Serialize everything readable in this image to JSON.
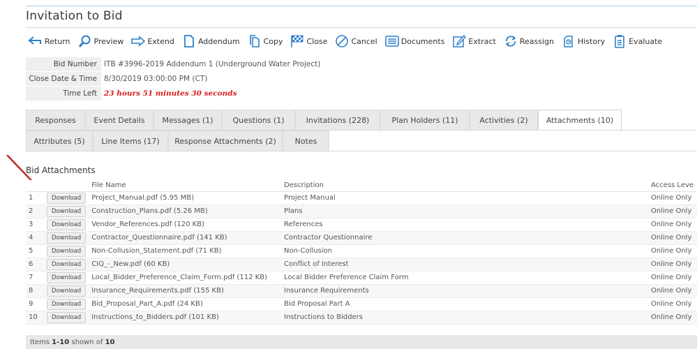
{
  "page": {
    "title": "Invitation to Bid"
  },
  "toolbar": {
    "buttons": [
      {
        "label": "Return",
        "icon": "return-arrow-icon"
      },
      {
        "label": "Preview",
        "icon": "magnifier-icon"
      },
      {
        "label": "Extend",
        "icon": "right-arrow-icon"
      },
      {
        "label": "Addendum",
        "icon": "document-icon"
      },
      {
        "label": "Copy",
        "icon": "copy-icon"
      },
      {
        "label": "Close",
        "icon": "checkered-flag-icon"
      },
      {
        "label": "Cancel",
        "icon": "cancel-circle-icon"
      },
      {
        "label": "Documents",
        "icon": "documents-icon"
      },
      {
        "label": "Extract",
        "icon": "edit-icon"
      },
      {
        "label": "Reassign",
        "icon": "reassign-icon"
      },
      {
        "label": "History",
        "icon": "history-icon"
      },
      {
        "label": "Evaluate",
        "icon": "clipboard-icon"
      }
    ],
    "icon_color": "#2f7fc8"
  },
  "info": {
    "bid_number_label": "Bid Number",
    "bid_number": "ITB #3996-2019 Addendum 1 (Underground Water Project)",
    "close_label": "Close Date & Time",
    "close_value": "8/30/2019 03:00:00 PM (CT)",
    "time_left_label": "Time Left",
    "time_left_value": "23 hours 51 minutes 30 seconds",
    "time_left_color": "#d81e1e"
  },
  "tabs": {
    "row1": [
      "Responses",
      "Event Details",
      "Messages (1)",
      "Questions (1)",
      "Invitations (228)",
      "Plan Holders (11)",
      "Activities (2)",
      "Attachments (10)"
    ],
    "row2": [
      "Attributes (5)",
      "Line Items (17)",
      "Response Attachments (2)",
      "Notes"
    ],
    "active": "Attachments (10)"
  },
  "attachments": {
    "section_title": "Bid Attachments",
    "columns": {
      "file_name": "File Name",
      "description": "Description",
      "access": "Access Leve"
    },
    "download_label": "Download",
    "rows": [
      {
        "num": "1",
        "file": "Project_Manual.pdf (5.95 MB)",
        "description": "Project Manual",
        "access": "Online Only"
      },
      {
        "num": "2",
        "file": "Construction_Plans.pdf (5.26 MB)",
        "description": "Plans",
        "access": "Online Only"
      },
      {
        "num": "3",
        "file": "Vendor_References.pdf (120 KB)",
        "description": "References",
        "access": "Online Only"
      },
      {
        "num": "4",
        "file": "Contractor_Questionnaire.pdf (141 KB)",
        "description": "Contractor Questionnaire",
        "access": "Online Only"
      },
      {
        "num": "5",
        "file": "Non-Collusion_Statement.pdf (71 KB)",
        "description": "Non-Collusion",
        "access": "Online Only"
      },
      {
        "num": "6",
        "file": "CIQ_-_New.pdf (60 KB)",
        "description": "Conflict of Interest",
        "access": "Online Only"
      },
      {
        "num": "7",
        "file": "Local_Bidder_Preference_Claim_Form.pdf (112 KB)",
        "description": "Local Bidder Preference Claim Form",
        "access": "Online Only"
      },
      {
        "num": "8",
        "file": "Insurance_Requirements.pdf (155 KB)",
        "description": "Insurance Requirements",
        "access": "Online Only"
      },
      {
        "num": "9",
        "file": "Bid_Proposal_Part_A.pdf (24 KB)",
        "description": "Bid Proposal Part A",
        "access": "Online Only"
      },
      {
        "num": "10",
        "file": "Instructions_to_Bidders.pdf (101 KB)",
        "description": "Instructions to Bidders",
        "access": "Online Only"
      }
    ],
    "footer": {
      "prefix": "Items",
      "range": "1-10",
      "middle": "shown of",
      "total": "10"
    }
  },
  "annotation": {
    "arrow_color": "#c0282a"
  }
}
